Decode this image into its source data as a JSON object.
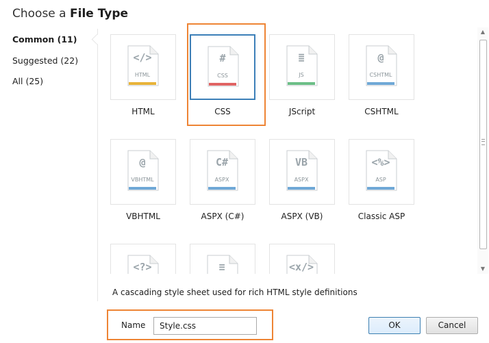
{
  "title": {
    "prefix": "Choose a",
    "bold": "File Type"
  },
  "categories": [
    {
      "label": "Common (11)",
      "selected": true
    },
    {
      "label": "Suggested (22)",
      "selected": false
    },
    {
      "label": "All (25)",
      "selected": false
    }
  ],
  "file_types": [
    {
      "name": "HTML",
      "symbol": "</>",
      "ext": "HTML",
      "stripe": "#e8b339",
      "icon": "html-file-icon",
      "selected": false
    },
    {
      "name": "CSS",
      "symbol": "#",
      "ext": "CSS",
      "stripe": "#e06464",
      "icon": "css-file-icon",
      "selected": true
    },
    {
      "name": "JScript",
      "symbol": "≣",
      "ext": "JS",
      "stripe": "#6cbf87",
      "icon": "jscript-file-icon",
      "selected": false
    },
    {
      "name": "CSHTML",
      "symbol": "@",
      "ext": "CSHTML",
      "stripe": "#6fa8d6",
      "icon": "cshtml-file-icon",
      "selected": false
    },
    {
      "name": "VBHTML",
      "symbol": "@",
      "ext": "VBHTML",
      "stripe": "#6fa8d6",
      "icon": "vbhtml-file-icon",
      "selected": false
    },
    {
      "name": "ASPX (C#)",
      "symbol": "C#",
      "ext": "ASPX",
      "stripe": "#6fa8d6",
      "icon": "aspx-cs-file-icon",
      "selected": false
    },
    {
      "name": "ASPX (VB)",
      "symbol": "VB",
      "ext": "ASPX",
      "stripe": "#6fa8d6",
      "icon": "aspx-vb-file-icon",
      "selected": false
    },
    {
      "name": "Classic ASP",
      "symbol": "<%>",
      "ext": "ASP",
      "stripe": "#6fa8d6",
      "icon": "asp-file-icon",
      "selected": false
    },
    {
      "name": "",
      "symbol": "<?>",
      "ext": "",
      "stripe": "#6fa8d6",
      "icon": "php-file-icon",
      "selected": false
    },
    {
      "name": "",
      "symbol": "≡",
      "ext": "",
      "stripe": "#9aa4aa",
      "icon": "text-file-icon",
      "selected": false
    },
    {
      "name": "",
      "symbol": "<x/>",
      "ext": "",
      "stripe": "#6fa8d6",
      "icon": "xml-file-icon",
      "selected": false
    }
  ],
  "description": "A cascading style sheet used for rich HTML style definitions",
  "name_field": {
    "label": "Name",
    "value": "Style.css"
  },
  "buttons": {
    "ok": "OK",
    "cancel": "Cancel"
  },
  "colors": {
    "selection_border": "#3b7fb8",
    "highlight_orange": "#ee8434"
  }
}
